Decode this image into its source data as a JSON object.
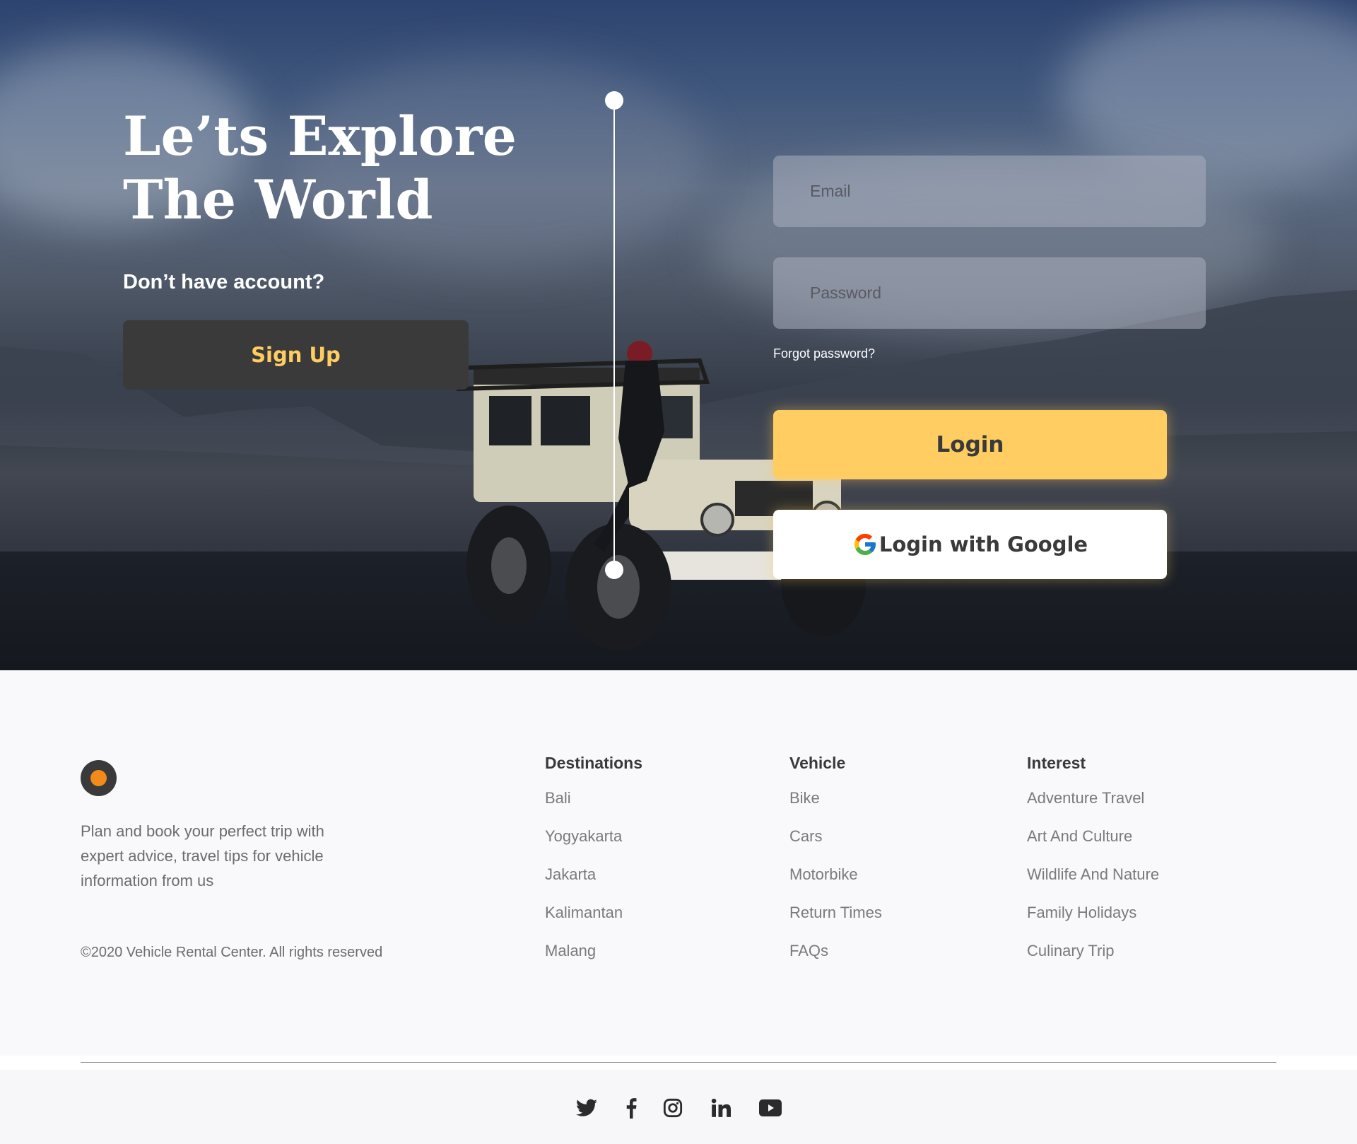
{
  "hero": {
    "title_line1": "Le’ts Explore",
    "title_line2": "The World",
    "question": "Don’t have account?",
    "signup_label": "Sign Up"
  },
  "login_form": {
    "email_placeholder": "Email",
    "password_placeholder": "Password",
    "forgot_label": "Forgot password?",
    "login_label": "Login",
    "google_label": "Login with Google",
    "google_icon": "google-g-icon"
  },
  "footer": {
    "logo_icon": "circle-logo",
    "description": "Plan and book your perfect trip with expert advice, travel tips for vehicle information from us",
    "copyright": "©2020 Vehicle Rental Center. All rights reserved",
    "columns": [
      {
        "title": "Destinations",
        "links": [
          "Bali",
          "Yogyakarta",
          "Jakarta",
          "Kalimantan",
          "Malang"
        ]
      },
      {
        "title": "Vehicle",
        "links": [
          "Bike",
          "Cars",
          "Motorbike",
          "Return Times",
          "FAQs"
        ]
      },
      {
        "title": "Interest",
        "links": [
          "Adventure Travel",
          "Art And Culture",
          "Wildlife And Nature",
          "Family Holidays",
          "Culinary Trip"
        ]
      }
    ],
    "socials": [
      "twitter-icon",
      "facebook-icon",
      "instagram-icon",
      "linkedin-icon",
      "youtube-icon"
    ]
  },
  "colors": {
    "accent": "#ffcd61",
    "dark": "#3a3a3a",
    "logo_dot": "#f28b1b"
  }
}
